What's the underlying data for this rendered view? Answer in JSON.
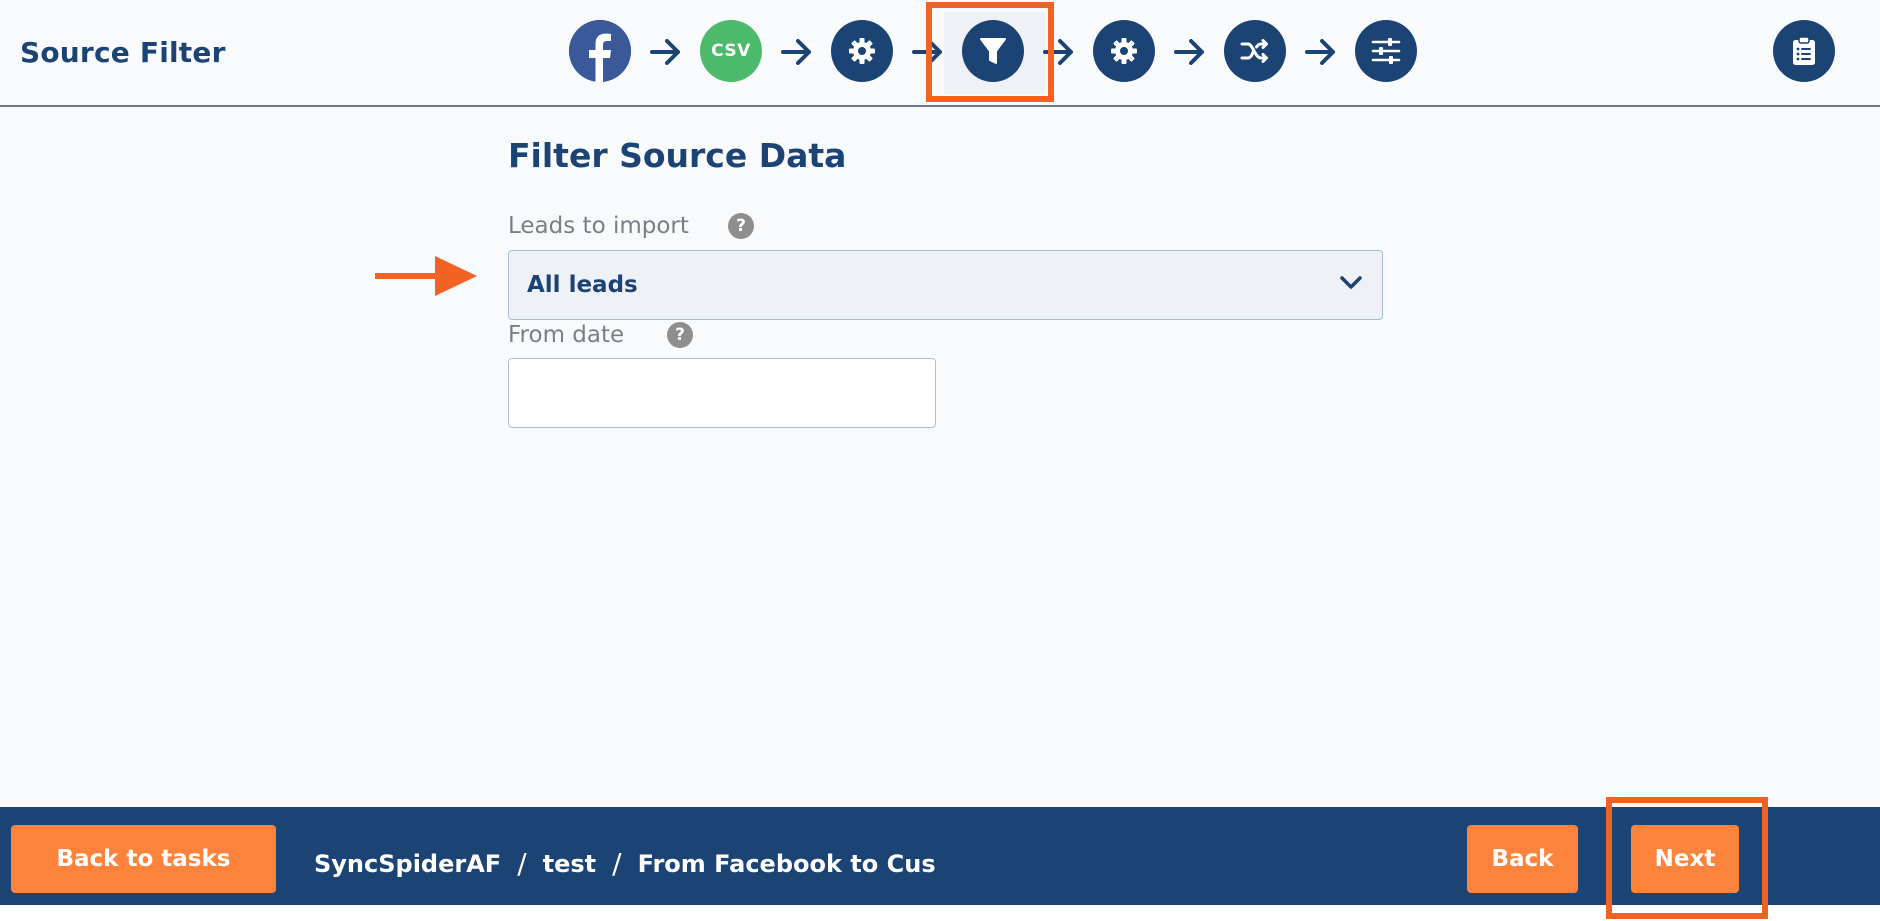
{
  "header": {
    "title": "Source Filter",
    "steps": [
      {
        "name": "facebook",
        "icon": "facebook-icon"
      },
      {
        "name": "csv",
        "icon": "csv-icon",
        "label": "CSV"
      },
      {
        "name": "settings",
        "icon": "gear-icon"
      },
      {
        "name": "filter",
        "icon": "filter-icon",
        "active": true
      },
      {
        "name": "settings-2",
        "icon": "gear-icon"
      },
      {
        "name": "mapping",
        "icon": "shuffle-icon"
      },
      {
        "name": "options",
        "icon": "sliders-icon"
      }
    ],
    "right_icon": "clipboard-icon"
  },
  "form": {
    "heading": "Filter Source Data",
    "leads_label": "Leads to import",
    "leads_value": "All leads",
    "help_glyph": "?",
    "from_date_label": "From date",
    "from_date_value": ""
  },
  "footer": {
    "back_to_tasks": "Back to tasks",
    "breadcrumb": [
      "SyncSpiderAF",
      "test",
      "From Facebook to Cus"
    ],
    "breadcrumb_separator": "/",
    "back": "Back",
    "next": "Next"
  },
  "colors": {
    "primary": "#1b4373",
    "accent": "#fc833b",
    "highlight": "#f26222",
    "facebook": "#3b5998",
    "csv": "#4cba6a"
  }
}
